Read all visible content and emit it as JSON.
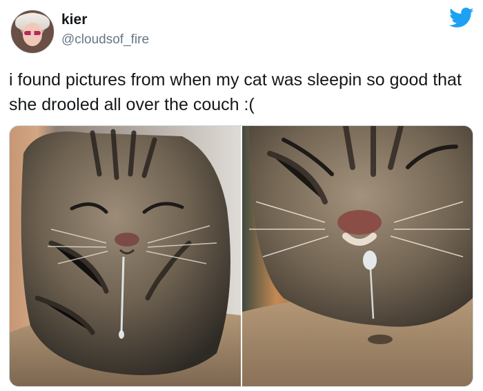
{
  "author": {
    "name": "kier",
    "handle": "@cloudsof_fire",
    "avatar_icon": "avatar-photo"
  },
  "platform_icon": "twitter-bird-icon",
  "brand_color": "#1da1f2",
  "tweet": {
    "text": "i found pictures from when my cat was sleepin so good that she drooled all over the couch :("
  },
  "media": [
    {
      "name": "cat-photo-left",
      "description_icon": "sleeping-tabby-cat-drooling"
    },
    {
      "name": "cat-photo-right",
      "description_icon": "sleeping-tabby-cat-closeup-drool-on-couch"
    }
  ]
}
